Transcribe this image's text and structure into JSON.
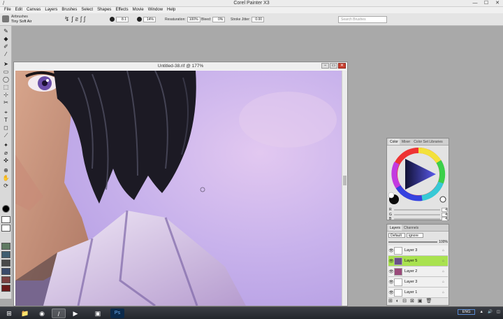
{
  "app": {
    "title": "Corel Painter X3",
    "logo_glyph": "/",
    "window_controls": [
      "—",
      "☐",
      "✕"
    ]
  },
  "menu": [
    "File",
    "Edit",
    "Canvas",
    "Layers",
    "Brushes",
    "Select",
    "Shapes",
    "Effects",
    "Movie",
    "Window",
    "Help"
  ],
  "property_bar": {
    "brush_category": "Airbrushes",
    "brush_variant": "Tiny Soft Air",
    "icons": [
      "↯",
      "ʃ",
      "ƨ",
      "ʃ",
      "ʃ"
    ],
    "size_value": "8.1",
    "opacity_value": "14%",
    "resaturation_label": "Resaturation:",
    "resaturation_value": "100%",
    "bleed_label": "Bleed:",
    "bleed_value": "0%",
    "stroke_jitter_label": "Stroke Jitter:",
    "stroke_jitter_value": "0.00",
    "search_placeholder": "Search Brushes"
  },
  "toolbox": {
    "tools": [
      "✎",
      "◆",
      "✐",
      "⁄",
      "➤",
      "▭",
      "◯",
      "⬚",
      "⊹",
      "✂",
      "⌖",
      "T",
      "◻",
      "⟋",
      "✦",
      "⌀",
      "✜",
      "⊕",
      "✋",
      "⟳"
    ],
    "main_color": "#000000",
    "swatch_colors": [
      "#ffffff",
      "#ffffff",
      "#5f7a62",
      "#3f5d70",
      "#4a4a4a",
      "#3a4a6a",
      "#7a4040",
      "#6a1a1a"
    ]
  },
  "document": {
    "title": "Untitled-38.rif @ 177%",
    "controls": [
      "−",
      "▭",
      "✕"
    ]
  },
  "color_panel": {
    "tabs": [
      "Color",
      "Mixer",
      "Color Set Libraries"
    ],
    "current_color": "#0a0a0a",
    "rgb": [
      {
        "label": "R",
        "value": "4"
      },
      {
        "label": "G",
        "value": "4"
      },
      {
        "label": "B",
        "value": "4"
      }
    ]
  },
  "layers_panel": {
    "tabs": [
      "Layers",
      "Channels"
    ],
    "composite_method": "Default",
    "blend_mode": "ignore",
    "opacity": "100%",
    "layers": [
      {
        "name": "Layer 3",
        "selected": false
      },
      {
        "name": "Layer 5",
        "selected": true
      },
      {
        "name": "Layer 2",
        "selected": false
      },
      {
        "name": "Layer 3",
        "selected": false
      },
      {
        "name": "Layer 1",
        "selected": false
      }
    ],
    "bottom_icons": [
      "⊞",
      "◐",
      "⊟",
      "⊠",
      "▣",
      "🗑"
    ]
  },
  "taskbar": {
    "start_glyph": "⊞",
    "apps": [
      {
        "name": "file-explorer",
        "glyph": "📁",
        "active": false
      },
      {
        "name": "firefox",
        "glyph": "◉",
        "active": false
      },
      {
        "name": "painter",
        "glyph": "/",
        "active": true
      },
      {
        "name": "media-player",
        "glyph": "▶",
        "active": false
      },
      {
        "name": "app-window",
        "glyph": "▣",
        "active": false
      },
      {
        "name": "photoshop",
        "glyph": "Ps",
        "active": false
      }
    ],
    "tray_items": [
      "ENG",
      "▲",
      "🔊",
      "◫"
    ]
  }
}
